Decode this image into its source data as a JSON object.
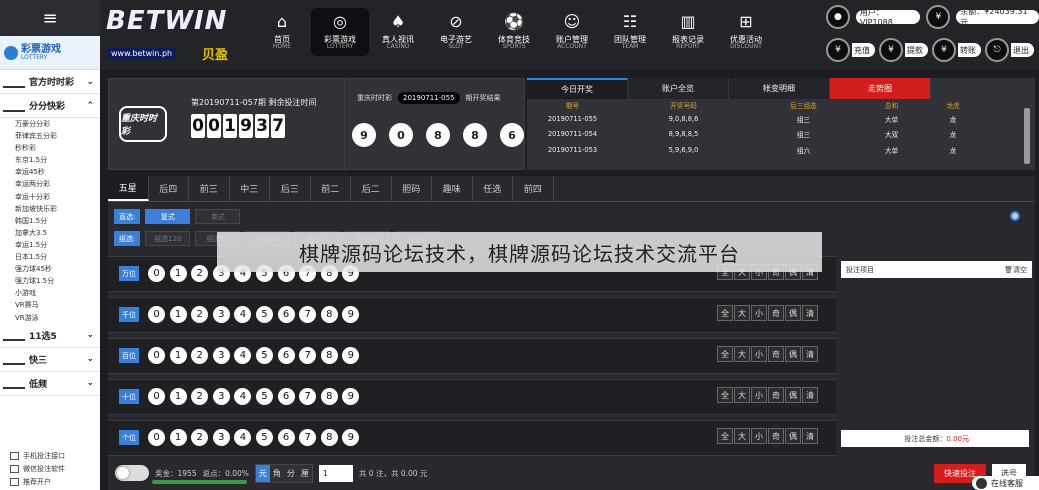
{
  "sidebar": {
    "lottery_title": "彩票游戏",
    "lottery_sub": "LOTTERY",
    "categories": [
      {
        "label": "官方时时彩",
        "logo": "ssc"
      },
      {
        "label": "分分快彩",
        "logo": "ffk"
      }
    ],
    "subitems": [
      "万豪分分彩",
      "菲律宾五分彩",
      "秒秒彩",
      "东京1.5分",
      "幸运45秒",
      "幸运两分彩",
      "幸运十分彩",
      "新加坡快乐彩",
      "韩国1.5分",
      "加拿大3.5",
      "幸运1.5分",
      "日本1.5分",
      "强力球45秒",
      "强力球1.5分",
      "小游戏",
      "VR赛马",
      "VR游泳"
    ],
    "categories2": [
      {
        "label": "11选5",
        "logo": "11x5"
      },
      {
        "label": "快三",
        "logo": "k3"
      },
      {
        "label": "低频",
        "logo": "dp"
      }
    ],
    "bottom_links": [
      "手机投注接口",
      "微信投注软件",
      "推荐开户"
    ]
  },
  "header": {
    "logo_text": "BETWIN",
    "logo_url": "www.betwin.ph",
    "logo_cn": "贝盈",
    "nav": [
      {
        "label": "首页",
        "en": "HOME",
        "icon": "home-icon",
        "glyph": "⌂"
      },
      {
        "label": "彩票游戏",
        "en": "LOTTERY",
        "icon": "lottery-icon",
        "glyph": "◎"
      },
      {
        "label": "真人视讯",
        "en": "CASINO",
        "icon": "cards-icon",
        "glyph": "♠"
      },
      {
        "label": "电子游艺",
        "en": "SLOT",
        "icon": "slot-icon",
        "glyph": "⊘"
      },
      {
        "label": "体育竞技",
        "en": "SPORTS",
        "icon": "ball-icon",
        "glyph": "⚽"
      },
      {
        "label": "账户管理",
        "en": "ACCOUNT",
        "icon": "person-icon",
        "glyph": "☺"
      },
      {
        "label": "团队管理",
        "en": "TEAM",
        "icon": "team-icon",
        "glyph": "☷"
      },
      {
        "label": "报表记录",
        "en": "REPORT",
        "icon": "chart-icon",
        "glyph": "▥"
      },
      {
        "label": "优惠活动",
        "en": "DISCOUNT",
        "icon": "gift-icon",
        "glyph": "⊞"
      }
    ],
    "user": "用户：VIP1088",
    "balance": "余额：¥24039.31元",
    "actions": [
      "充值",
      "提款",
      "转账",
      "退出"
    ]
  },
  "draw": {
    "game_logo": "重庆时时彩",
    "period_text": "第20190711-057期 剩余投注时间",
    "countdown": [
      "0",
      "0",
      "1",
      "9",
      "3",
      "7"
    ],
    "last_label": "重庆时时彩",
    "last_period": "20190711-055",
    "last_suffix": "期开奖结果",
    "balls": [
      "9",
      "0",
      "8",
      "8",
      "6"
    ]
  },
  "history": {
    "tabs": [
      "今日开奖",
      "账户全览",
      "帐变明细",
      "走势图"
    ],
    "headers": [
      "期号",
      "开奖号码",
      "后三组态",
      "总和",
      "龙虎"
    ],
    "rows": [
      [
        "20190711-055",
        "9,0,8,8,6",
        "组三",
        "大单",
        "龙"
      ],
      [
        "20190711-054",
        "8,9,8,8,5",
        "组三",
        "大双",
        "龙"
      ],
      [
        "20190711-053",
        "5,9,6,9,0",
        "组六",
        "大单",
        "龙"
      ]
    ]
  },
  "bet": {
    "tabs": [
      "五星",
      "后四",
      "前三",
      "中三",
      "后三",
      "前二",
      "后二",
      "胆码",
      "趣味",
      "任选",
      "前四"
    ],
    "mode_label": "直选:",
    "mode_options": [
      "复式",
      "单式"
    ],
    "group_label": "组选:",
    "group_options": [
      "组选120",
      "组选60",
      "组选30",
      "组选20",
      "组选10",
      "组选5"
    ],
    "positions": [
      "万位",
      "千位",
      "百位",
      "十位",
      "个位"
    ],
    "digits": [
      "0",
      "1",
      "2",
      "3",
      "4",
      "5",
      "6",
      "7",
      "8",
      "9"
    ],
    "quick": [
      "全",
      "大",
      "小",
      "奇",
      "偶",
      "清"
    ],
    "cart_title": "投注项目",
    "cart_clear": "🗑清空",
    "cart_total_label": "投注总金额：",
    "cart_total": "0.00元"
  },
  "footer": {
    "prize": "奖金：1955",
    "rebate": "返点：0.00%",
    "units": [
      "元",
      "角",
      "分",
      "厘"
    ],
    "multiplier": "1",
    "summary": "共 0 注，共 0.00 元",
    "quick_bet": "快速投注",
    "select": "选号"
  },
  "overlay_text": "棋牌源码论坛技术，棋牌源码论坛技术交流平台",
  "chat": "在线客服"
}
